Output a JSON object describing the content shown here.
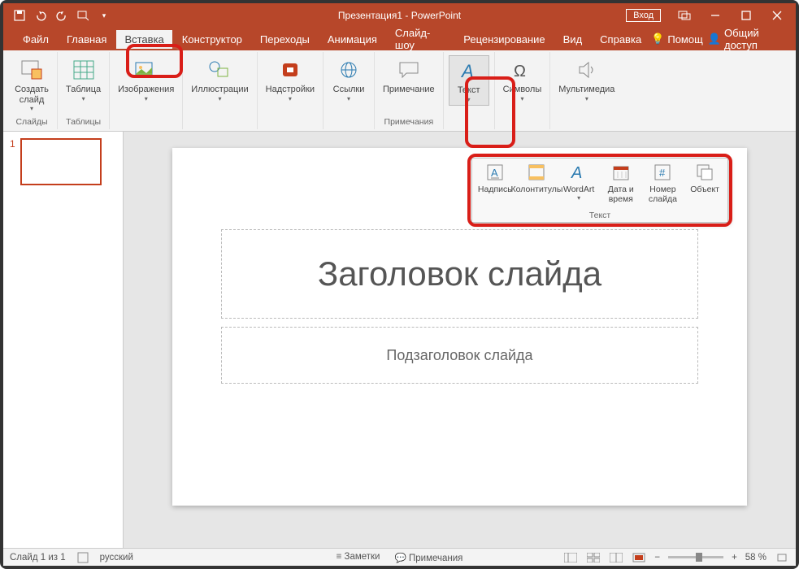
{
  "title": "Презентация1 - PowerPoint",
  "login": "Вход",
  "tabs": [
    "Файл",
    "Главная",
    "Вставка",
    "Конструктор",
    "Переходы",
    "Анимация",
    "Слайд-шоу",
    "Рецензирование",
    "Вид",
    "Справка"
  ],
  "activeTab": 2,
  "help": {
    "tellme": "Помощ",
    "share": "Общий доступ"
  },
  "ribbon": {
    "groups": [
      {
        "label": "Слайды",
        "items": [
          {
            "key": "new-slide",
            "label": "Создать\nслайд",
            "dd": true
          }
        ]
      },
      {
        "label": "Таблицы",
        "items": [
          {
            "key": "table",
            "label": "Таблица",
            "dd": true
          }
        ]
      },
      {
        "label": "",
        "items": [
          {
            "key": "images",
            "label": "Изображения",
            "dd": true
          }
        ]
      },
      {
        "label": "",
        "items": [
          {
            "key": "illust",
            "label": "Иллюстрации",
            "dd": true
          }
        ]
      },
      {
        "label": "",
        "items": [
          {
            "key": "addins",
            "label": "Надстройки",
            "dd": true
          }
        ]
      },
      {
        "label": "",
        "items": [
          {
            "key": "links",
            "label": "Ссылки",
            "dd": true
          }
        ]
      },
      {
        "label": "Примечания",
        "items": [
          {
            "key": "comment",
            "label": "Примечание"
          }
        ]
      },
      {
        "label": "",
        "items": [
          {
            "key": "text",
            "label": "Текст",
            "dd": true,
            "active": true
          }
        ]
      },
      {
        "label": "",
        "items": [
          {
            "key": "symbols",
            "label": "Символы",
            "dd": true
          }
        ]
      },
      {
        "label": "",
        "items": [
          {
            "key": "media",
            "label": "Мультимедиа",
            "dd": true
          }
        ]
      }
    ]
  },
  "popup": {
    "label": "Текст",
    "items": [
      {
        "key": "textbox",
        "label": "Надпись"
      },
      {
        "key": "headerfooter",
        "label": "Колонтитулы"
      },
      {
        "key": "wordart",
        "label": "WordArt",
        "dd": true
      },
      {
        "key": "datetime",
        "label": "Дата и\nвремя"
      },
      {
        "key": "slidenum",
        "label": "Номер\nслайда"
      },
      {
        "key": "object",
        "label": "Объект"
      }
    ]
  },
  "thumb": {
    "num": "1"
  },
  "slide": {
    "title": "Заголовок слайда",
    "subtitle": "Подзаголовок слайда"
  },
  "status": {
    "slide": "Слайд 1 из 1",
    "lang": "русский",
    "notes": "Заметки",
    "comments": "Примечания",
    "zoom": "58 %"
  }
}
